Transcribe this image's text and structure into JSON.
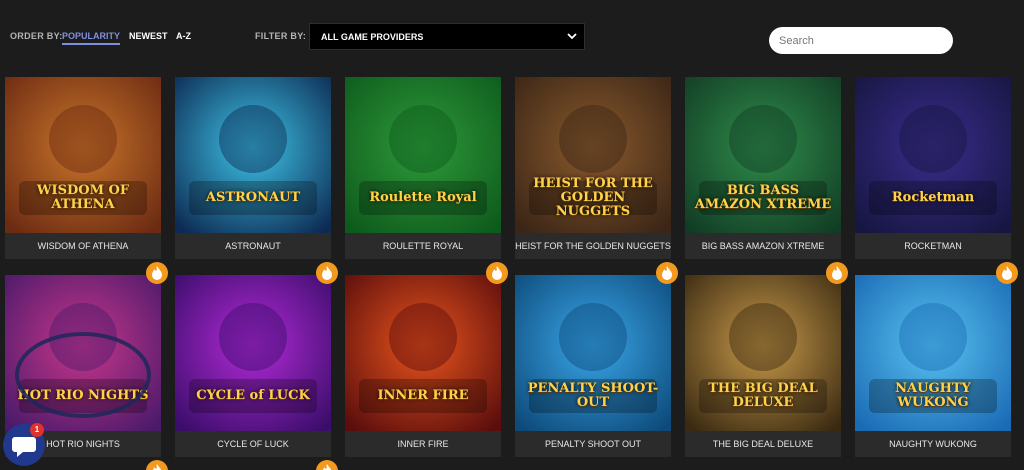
{
  "toolbar": {
    "order_label": "ORDER BY:",
    "order_options": [
      "POPULARITY",
      "NEWEST",
      "A-Z"
    ],
    "order_active": "POPULARITY",
    "filter_label": "FILTER BY:",
    "filter_value": "ALL GAME PROVIDERS",
    "search_placeholder": "Search"
  },
  "games": [
    {
      "name": "WISDOM OF ATHENA",
      "art_text": "WISDOM OF ATHENA",
      "hot": false,
      "colors": [
        "#6b2a12",
        "#c9752a"
      ]
    },
    {
      "name": "ASTRONAUT",
      "art_text": "ASTRONAUT",
      "hot": false,
      "colors": [
        "#0d2a52",
        "#3ec4e8"
      ]
    },
    {
      "name": "ROULETTE ROYAL",
      "art_text": "Roulette Royal",
      "hot": false,
      "colors": [
        "#0e5a1c",
        "#2e9a3a"
      ]
    },
    {
      "name": "HEIST FOR THE GOLDEN NUGGETS",
      "art_text": "HEIST FOR THE GOLDEN NUGGETS",
      "hot": false,
      "colors": [
        "#3a2516",
        "#8a5a2c"
      ]
    },
    {
      "name": "BIG BASS AMAZON XTREME",
      "art_text": "BIG BASS AMAZON XTREME",
      "hot": false,
      "colors": [
        "#123d25",
        "#2f8c4a"
      ]
    },
    {
      "name": "ROCKETMAN",
      "art_text": "Rocketman",
      "hot": false,
      "colors": [
        "#161641",
        "#3a2d8c"
      ]
    },
    {
      "name": "HOT RIO NIGHTS",
      "art_text": "HOT RIO NIGHTS",
      "hot": true,
      "colors": [
        "#4a1a6a",
        "#c8368a"
      ]
    },
    {
      "name": "CYCLE OF LUCK",
      "art_text": "CYCLE of LUCK",
      "hot": true,
      "colors": [
        "#3a0d6a",
        "#b22ad6"
      ]
    },
    {
      "name": "INNER FIRE",
      "art_text": "INNER FIRE",
      "hot": true,
      "colors": [
        "#5a0d0d",
        "#e8541c"
      ]
    },
    {
      "name": "PENALTY SHOOT OUT",
      "art_text": "PENALTY SHOOT-OUT",
      "hot": true,
      "colors": [
        "#0d4a7a",
        "#3aa6e8"
      ]
    },
    {
      "name": "THE BIG DEAL DELUXE",
      "art_text": "THE BIG DEAL DELUXE",
      "hot": true,
      "colors": [
        "#3a2a12",
        "#c89a4a"
      ]
    },
    {
      "name": "NAUGHTY WUKONG",
      "art_text": "NAUGHTY WUKONG",
      "hot": true,
      "colors": [
        "#1a6ab4",
        "#58c2f0"
      ]
    }
  ],
  "partial_row_hot": [
    true,
    true
  ],
  "chat": {
    "badge": "1",
    "icon": "chat-icon"
  },
  "colors": {
    "background": "#1c1c1c",
    "card_label": "#2b2b2b",
    "accent": "#7f8fe0",
    "hot_badge": "#f39a1e",
    "chat": "#21398c"
  }
}
